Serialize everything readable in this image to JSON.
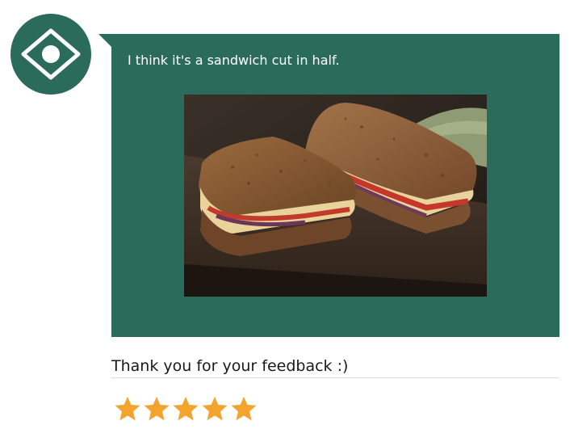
{
  "bot": {
    "avatar_icon": "eye-icon",
    "brand_color": "#2a6b5c"
  },
  "message": {
    "text": "I think it's a sandwich cut in half.",
    "image_icon": "sandwich-photo"
  },
  "feedback": {
    "text": "Thank you for your feedback :)"
  },
  "rating": {
    "value": 5,
    "max": 5,
    "star_color": "#f2a42d"
  }
}
